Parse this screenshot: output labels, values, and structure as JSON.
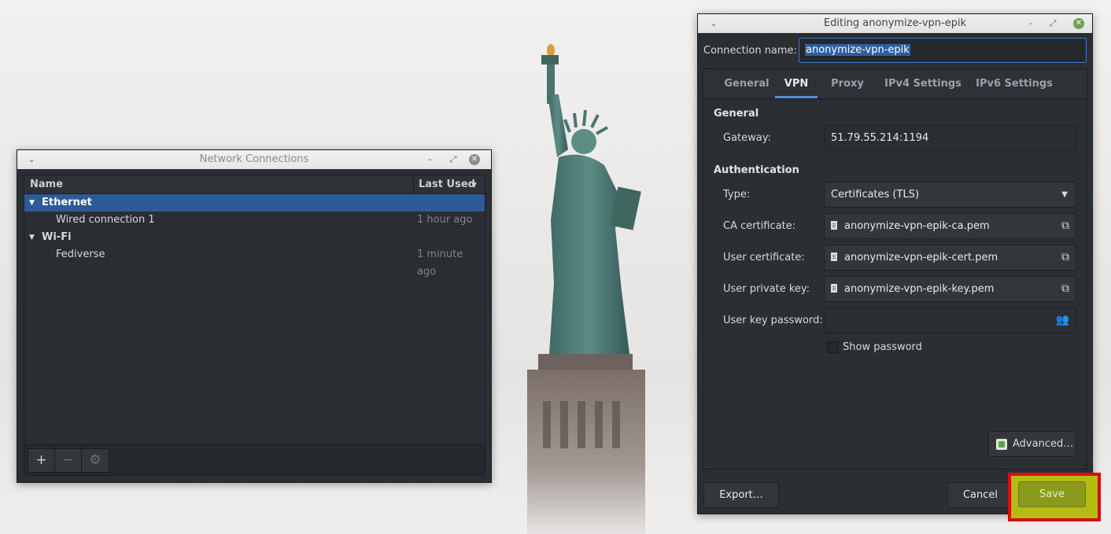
{
  "network_window": {
    "title": "Network Connections",
    "columns": {
      "name": "Name",
      "last_used": "Last Used"
    },
    "groups": [
      {
        "label": "Ethernet",
        "items": [
          {
            "name": "Wired connection 1",
            "last_used": "1 hour ago"
          }
        ]
      },
      {
        "label": "Wi-Fi",
        "items": [
          {
            "name": "Fediverse",
            "last_used": "1 minute ago"
          }
        ]
      }
    ],
    "toolbar": {
      "add": "+",
      "remove": "−",
      "settings": "⚙"
    }
  },
  "edit_window": {
    "title": "Editing anonymize-vpn-epik",
    "connection_name_label": "Connection name:",
    "connection_name_value": "anonymize-vpn-epik",
    "tabs": [
      "General",
      "VPN",
      "Proxy",
      "IPv4 Settings",
      "IPv6 Settings"
    ],
    "active_tab": "VPN",
    "general_section": "General",
    "gateway_label": "Gateway:",
    "gateway_value": "51.79.55.214:1194",
    "auth_section": "Authentication",
    "type_label": "Type:",
    "type_value": "Certificates (TLS)",
    "ca_label": "CA certificate:",
    "ca_value": "anonymize-vpn-epik-ca.pem",
    "user_cert_label": "User certificate:",
    "user_cert_value": "anonymize-vpn-epik-cert.pem",
    "user_key_label": "User private key:",
    "user_key_value": "anonymize-vpn-epik-key.pem",
    "key_password_label": "User key password:",
    "key_password_value": "",
    "show_password_label": "Show password",
    "show_password_checked": false,
    "advanced_label": "Advanced…",
    "export_label": "Export…",
    "cancel_label": "Cancel",
    "save_label": "Save"
  },
  "colors": {
    "selection": "#2d5b98",
    "tab_accent": "#4f8fd9",
    "save": "#8a9a1c",
    "highlight": "#d40f0f"
  }
}
